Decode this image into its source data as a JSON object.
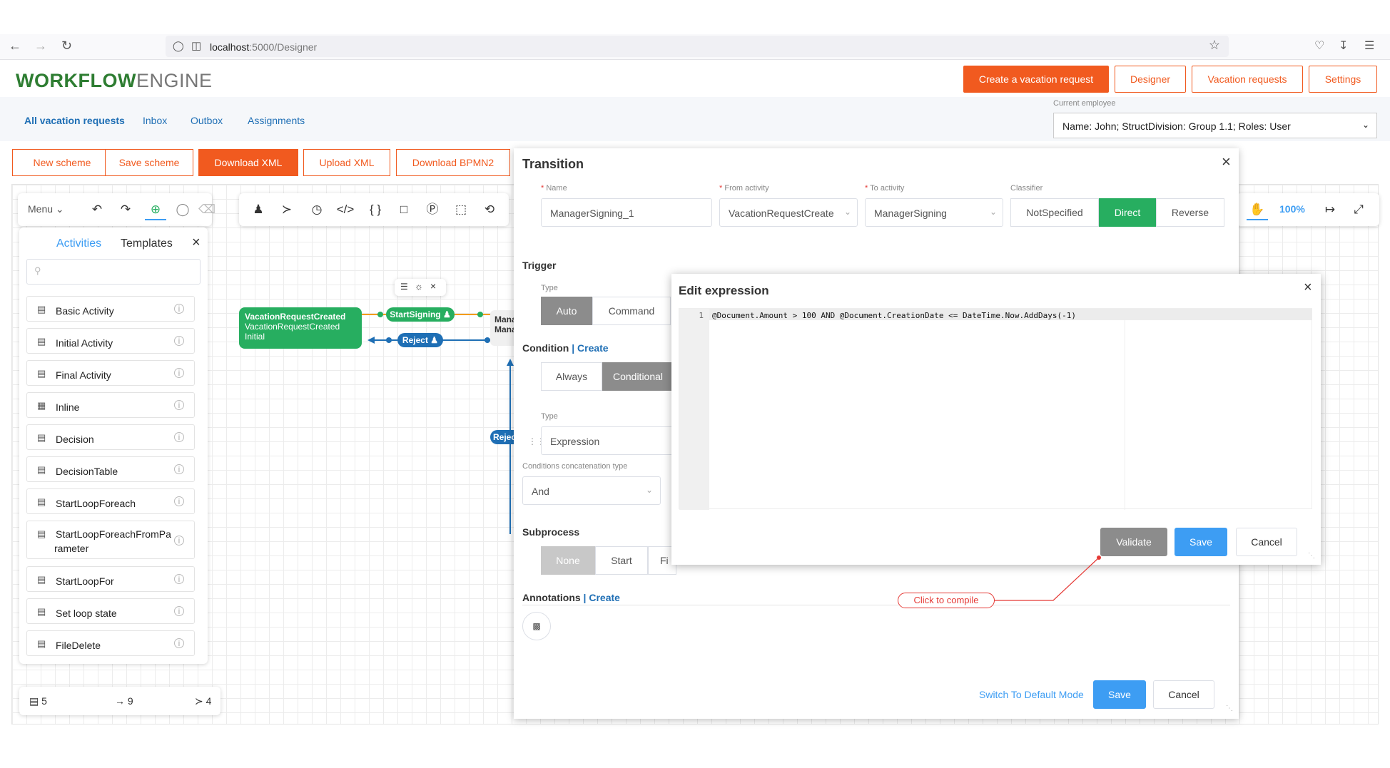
{
  "browser": {
    "url_host": "localhost",
    "url_path": ":5000/Designer"
  },
  "app": {
    "logo_part1": "WORKFLOW",
    "logo_part2": "ENGINE",
    "top_buttons": [
      "Create a vacation request",
      "Designer",
      "Vacation requests",
      "Settings"
    ]
  },
  "subnav": {
    "links": [
      "All vacation requests",
      "Inbox",
      "Outbox",
      "Assignments"
    ],
    "employee_label": "Current employee",
    "employee_value": "Name: John; StructDivision: Group 1.1; Roles: User"
  },
  "scheme_buttons": [
    "New scheme",
    "Save scheme",
    "Download XML",
    "Upload XML",
    "Download BPMN2"
  ],
  "canvas": {
    "menu_label": "Menu",
    "zoom": "100%",
    "tabs": {
      "activities": "Activities",
      "templates": "Templates"
    },
    "activity_items": [
      "Basic Activity",
      "Initial Activity",
      "Final Activity",
      "Inline",
      "Decision",
      "DecisionTable",
      "StartLoopForeach",
      "StartLoopForeachFromParameter",
      "StartLoopFor",
      "Set loop state",
      "FileDelete"
    ],
    "activity_item_multiline": [
      "StartLoopForeachFromPa",
      "rameter"
    ],
    "stats": {
      "activities": "5",
      "transitions": "9",
      "commands": "4"
    },
    "node_initial": [
      "VacationRequestCreated",
      "VacationRequestCreated",
      "Initial"
    ],
    "node_manager": [
      "Manag",
      "Manag"
    ],
    "pill_startsigning": "StartSigning",
    "pill_reject": "Reject",
    "pill_reject2": "Rejec"
  },
  "transition": {
    "title": "Transition",
    "labels": {
      "name": "Name",
      "from": "From activity",
      "to": "To activity",
      "classifier": "Classifier"
    },
    "values": {
      "name": "ManagerSigning_1",
      "from": "VacationRequestCreate",
      "to": "ManagerSigning"
    },
    "classifier_options": [
      "NotSpecified",
      "Direct",
      "Reverse"
    ],
    "trigger": {
      "title": "Trigger",
      "type_label": "Type",
      "options": [
        "Auto",
        "Command"
      ]
    },
    "condition": {
      "title": "Condition",
      "create": "| Create",
      "options": [
        "Always",
        "Conditional"
      ],
      "type_label": "Type",
      "type_value": "Expression",
      "concat_label": "Conditions concatenation type",
      "concat_value": "And"
    },
    "subprocess": {
      "title": "Subprocess",
      "options": [
        "None",
        "Start",
        "Fi"
      ]
    },
    "annotations": {
      "title": "Annotations",
      "create": "| Create"
    },
    "switch_mode": "Switch To Default Mode",
    "save": "Save",
    "cancel": "Cancel"
  },
  "edit_expression": {
    "title": "Edit expression",
    "line_number": "1",
    "code": "@Document.Amount > 100 AND @Document.CreationDate <= DateTime.Now.AddDays(-1)",
    "validate": "Validate",
    "save": "Save",
    "cancel": "Cancel"
  },
  "tooltip": {
    "compile": "Click to compile"
  },
  "colors": {
    "accent": "#f15a1f",
    "green": "#27ae60",
    "blue": "#3d9df3",
    "link": "#1f6fb5"
  }
}
